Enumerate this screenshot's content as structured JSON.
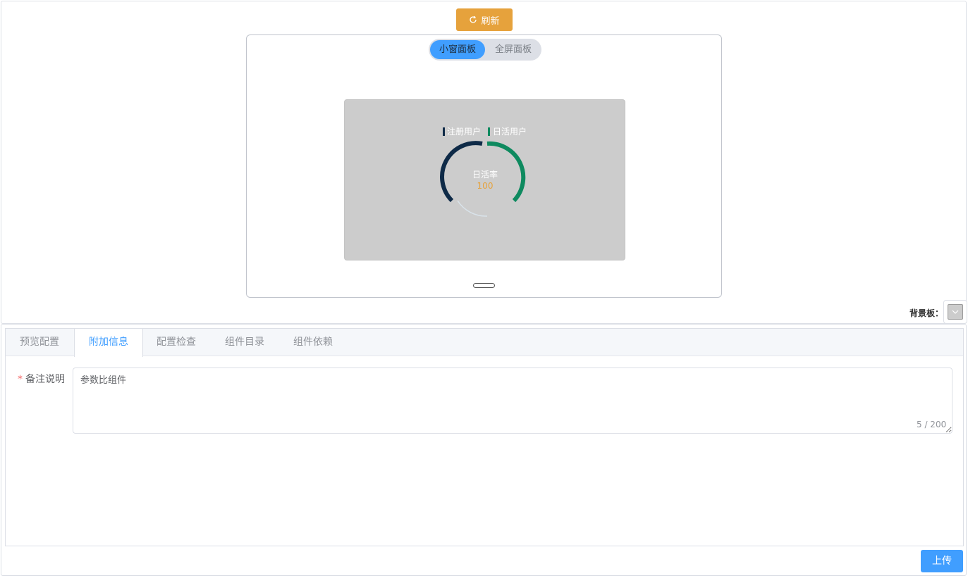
{
  "toolbar": {
    "refresh_label": "刷新"
  },
  "panel_switch": {
    "small": "小窗面板",
    "full": "全屏面板"
  },
  "chart_data": {
    "type": "gauge",
    "legend": [
      "注册用户",
      "日活用户"
    ],
    "center_label": "日活率",
    "center_value": "100",
    "series": [
      {
        "name": "注册用户",
        "color": "#0e2a47"
      },
      {
        "name": "日活用户",
        "color": "#0e8a5f"
      }
    ],
    "placement": "legend-top",
    "colors": {
      "card_bg": "#cccccc",
      "label": "#ffffff",
      "value": "#e6a23c"
    }
  },
  "background": {
    "label": "背景板：",
    "color": "#cccccc"
  },
  "tabs": [
    {
      "label": "预览配置"
    },
    {
      "label": "附加信息"
    },
    {
      "label": "配置检查"
    },
    {
      "label": "组件目录"
    },
    {
      "label": "组件依赖"
    }
  ],
  "form": {
    "remark_required": "*",
    "remark_label": "备注说明",
    "remark_value": "参数比组件",
    "word_count": "5 / 200"
  },
  "footer": {
    "upload_label": "上传"
  },
  "colors": {
    "accent": "#409eff",
    "warning": "#e6a23c"
  }
}
